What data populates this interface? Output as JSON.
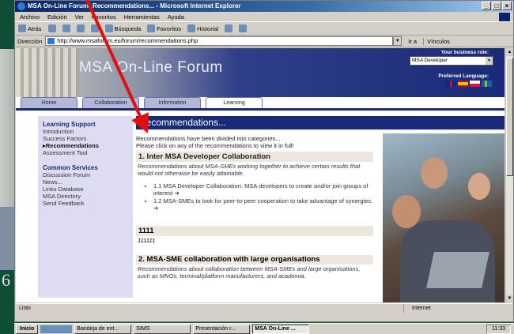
{
  "browser": {
    "title": "MSA On-Line Forum: Recommendations... - Microsoft Internet Explorer",
    "menu": [
      "Archivo",
      "Edición",
      "Ver",
      "Favoritos",
      "Herramientas",
      "Ayuda"
    ],
    "toolbar": [
      "Atrás",
      "Búsqueda",
      "Favoritos",
      "Historial"
    ],
    "address_label": "Dirección",
    "url": "http://www.msaforum.eu/forum/recommendations.php",
    "go_label": "Ir a",
    "links_label": "Vínculos",
    "status_left": "Listo",
    "status_zone": "Internet"
  },
  "banner": {
    "title": "MSA On-Line Forum",
    "role_label": "Your business role:",
    "role_value": "MSA Developer",
    "language_label": "Preferred Language:"
  },
  "tabs": [
    "Home",
    "Collaboration",
    "Information",
    "Learning"
  ],
  "active_tab": "Learning",
  "sidebar": {
    "section1_title": "Learning Support",
    "section1_items": [
      "Introduction",
      "Success Factors",
      "Recommendations",
      "Assessment Tool"
    ],
    "current_item": "Recommendations",
    "section2_title": "Common Services",
    "section2_items": [
      "Discussion Forum",
      "News...",
      "Links Database",
      "MSA Directory",
      "Send Feedback"
    ]
  },
  "content": {
    "heading": "Recommendations...",
    "intro_1": "Recommendations have been divided into categories...",
    "intro_2": "Please click on any of the recommendations to view it in full!",
    "sec1_title": "1. Inter MSA Developer Collaboration",
    "sec1_desc": "Recommendations about MSA-SMEs working together to achieve certain results that would not otherwise be easily attainable.",
    "sec1_items": [
      "1.1 MSA Developer Collaboration: MSA developers to create and/or join groups of interest ➜",
      "1.2 MSA-SMEs to look for peer-to-peer cooperation to take advantage of synergies. ➜"
    ],
    "sec_test_title": "1111",
    "sec_test_value": "111111",
    "sec2_title": "2. MSA-SME collaboration with large organisations",
    "sec2_desc": "Recommendations about collaboration between MSA-SMEs and large organisations, such as MNOs, terminal/platform manufacturers, and academia."
  },
  "taskbar": {
    "start": "Inicio",
    "tasks": [
      "Bandeja de ent...",
      "SIMS",
      "Presentación r...",
      "MSA On-Line ..."
    ],
    "active_task": "MSA On-Line ...",
    "clock": "11:33"
  },
  "colors": {
    "accent": "#1a2a78",
    "arrow": "#e01010"
  },
  "background_text": "6"
}
